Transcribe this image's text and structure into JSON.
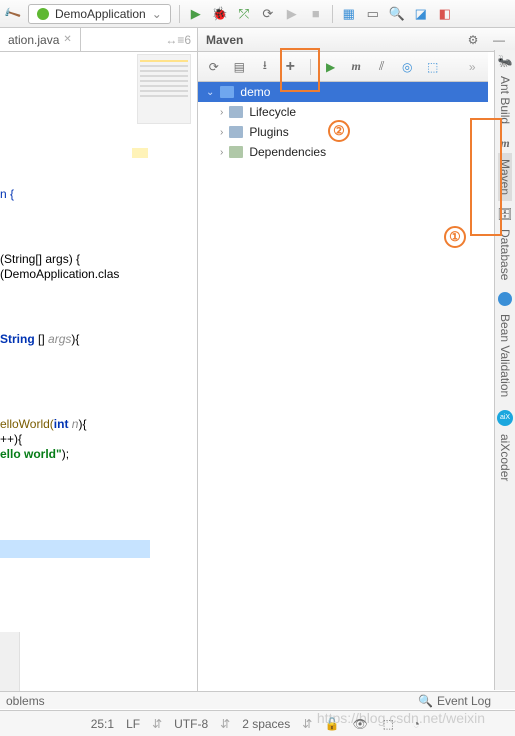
{
  "toolbar": {
    "run_config": "DemoApplication"
  },
  "tabs": {
    "editor_tab": "ation.java",
    "editor_marker": "↔≡6"
  },
  "maven": {
    "title": "Maven",
    "root": "demo",
    "nodes": [
      "Lifecycle",
      "Plugins",
      "Dependencies"
    ]
  },
  "rail": {
    "ant": "Ant Build",
    "maven": "Maven",
    "db": "Database",
    "bean": "Bean Validation",
    "aix": "aiXcoder"
  },
  "status": {
    "problems": "oblems",
    "event_log": "Event Log"
  },
  "status2": {
    "pos": "25:1",
    "lf": "LF",
    "enc": "UTF-8",
    "indent": "2 spaces"
  },
  "code": {
    "l1": "n {",
    "l2a": "(String[] args) {",
    "l2b": "(DemoApplication.clas",
    "l3a": "String",
    "l3b": " []",
    "l3c": " args",
    "l3d": "){",
    "l4a": "elloWorld(",
    "l4b": "int",
    "l4c": " n",
    "l4d": "){",
    "l5": "++){",
    "l6a": "ello world\"",
    "l6b": ");"
  },
  "annotations": {
    "one": "①",
    "two": "②"
  },
  "watermark": "https://blog.csdn.net/weixin"
}
